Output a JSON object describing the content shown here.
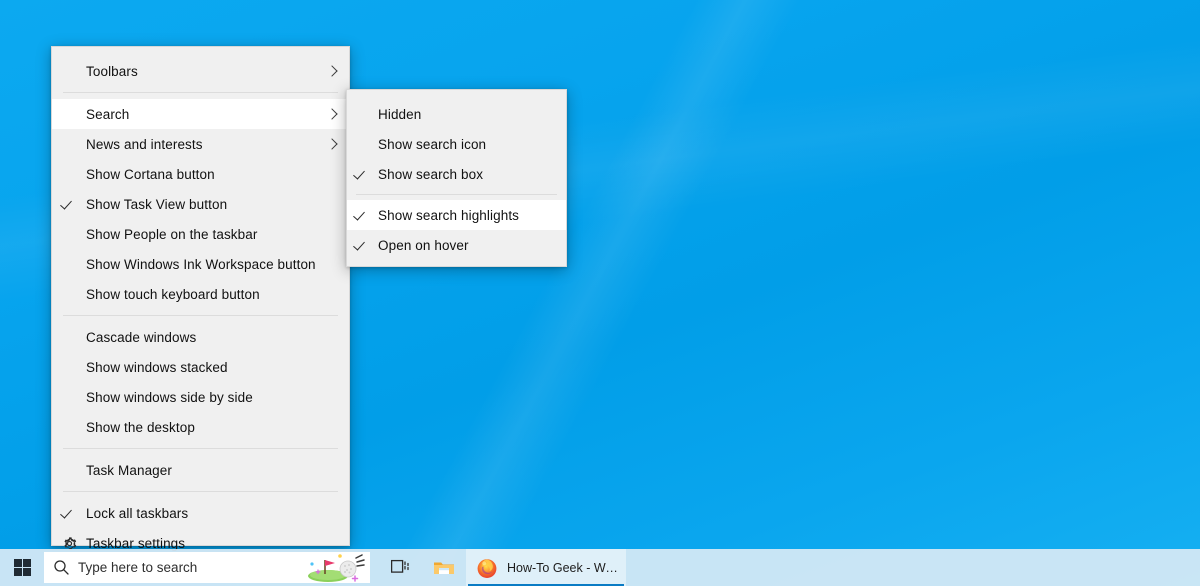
{
  "desktop": {
    "background_color": "#02a0e9",
    "accent_color": "#0078d7"
  },
  "context_menu": {
    "name": "Taskbar context menu",
    "items": [
      {
        "label": "Toolbars",
        "checked": false,
        "submenu": true,
        "highlighted": false,
        "icon": ""
      },
      {
        "separator": true
      },
      {
        "label": "Search",
        "checked": false,
        "submenu": true,
        "highlighted": true,
        "icon": ""
      },
      {
        "label": "News and interests",
        "checked": false,
        "submenu": true,
        "highlighted": false,
        "icon": ""
      },
      {
        "label": "Show Cortana button",
        "checked": false,
        "submenu": false,
        "highlighted": false,
        "icon": ""
      },
      {
        "label": "Show Task View button",
        "checked": true,
        "submenu": false,
        "highlighted": false,
        "icon": ""
      },
      {
        "label": "Show People on the taskbar",
        "checked": false,
        "submenu": false,
        "highlighted": false,
        "icon": ""
      },
      {
        "label": "Show Windows Ink Workspace button",
        "checked": false,
        "submenu": false,
        "highlighted": false,
        "icon": ""
      },
      {
        "label": "Show touch keyboard button",
        "checked": false,
        "submenu": false,
        "highlighted": false,
        "icon": ""
      },
      {
        "separator": true
      },
      {
        "label": "Cascade windows",
        "checked": false,
        "submenu": false,
        "highlighted": false,
        "icon": ""
      },
      {
        "label": "Show windows stacked",
        "checked": false,
        "submenu": false,
        "highlighted": false,
        "icon": ""
      },
      {
        "label": "Show windows side by side",
        "checked": false,
        "submenu": false,
        "highlighted": false,
        "icon": ""
      },
      {
        "label": "Show the desktop",
        "checked": false,
        "submenu": false,
        "highlighted": false,
        "icon": ""
      },
      {
        "separator": true
      },
      {
        "label": "Task Manager",
        "checked": false,
        "submenu": false,
        "highlighted": false,
        "icon": ""
      },
      {
        "separator": true
      },
      {
        "label": "Lock all taskbars",
        "checked": true,
        "submenu": false,
        "highlighted": false,
        "icon": ""
      },
      {
        "label": "Taskbar settings",
        "checked": false,
        "submenu": false,
        "highlighted": false,
        "icon": "gear-icon"
      }
    ]
  },
  "search_submenu": {
    "name": "Search submenu",
    "items": [
      {
        "label": "Hidden",
        "checked": false,
        "highlighted": false
      },
      {
        "label": "Show search icon",
        "checked": false,
        "highlighted": false
      },
      {
        "label": "Show search box",
        "checked": true,
        "highlighted": false
      },
      {
        "separator": true
      },
      {
        "label": "Show search highlights",
        "checked": true,
        "highlighted": true
      },
      {
        "label": "Open on hover",
        "checked": true,
        "highlighted": false
      }
    ]
  },
  "taskbar": {
    "start_button_label": "Start",
    "search": {
      "placeholder": "Type here to search",
      "icon": "search-icon",
      "highlight_art": "golf-search-highlight-icon"
    },
    "task_view_label": "Task View",
    "apps": [
      {
        "name": "File Explorer",
        "title": "",
        "icon": "file-explorer-icon",
        "active": false
      },
      {
        "name": "Firefox",
        "title": "How-To Geek - We ...",
        "icon": "firefox-icon",
        "active": true
      }
    ]
  }
}
